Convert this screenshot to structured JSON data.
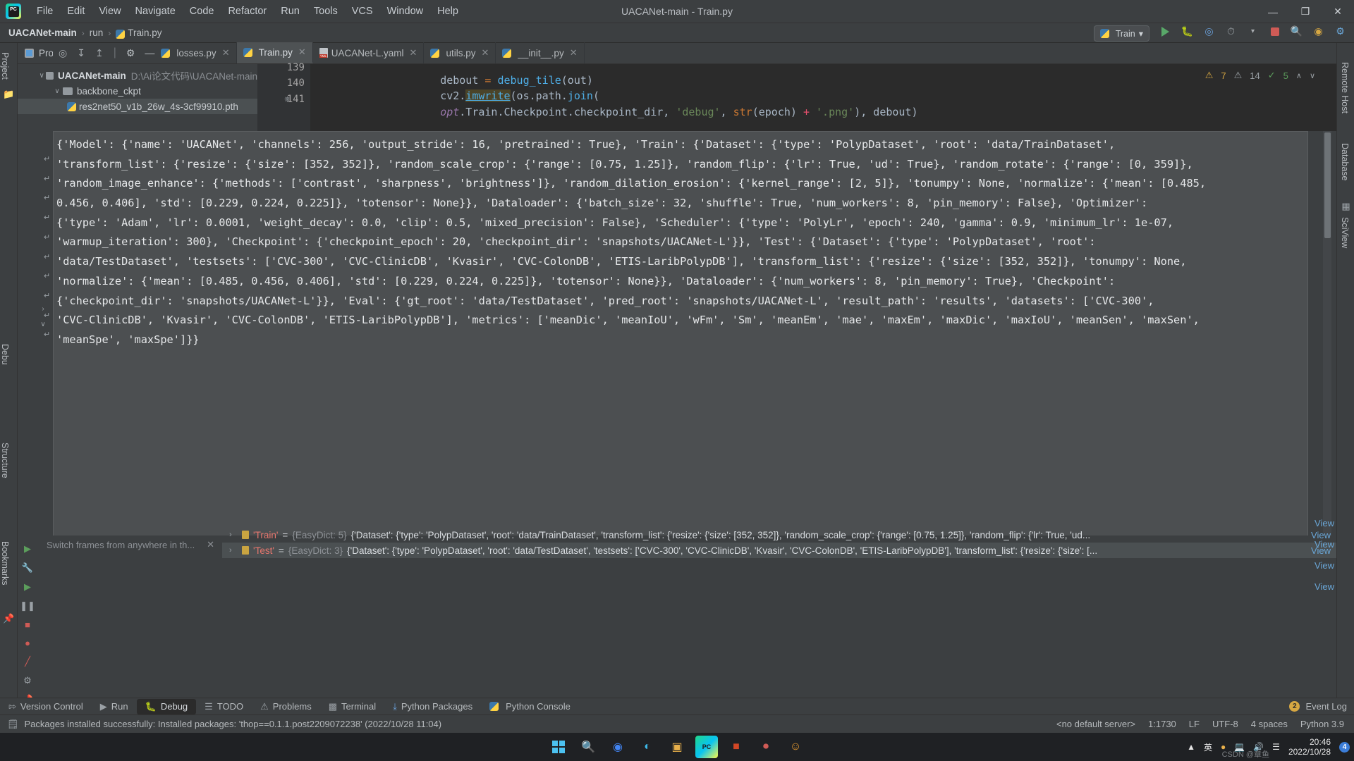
{
  "window": {
    "title": "UACANet-main - Train.py",
    "menu": [
      "File",
      "Edit",
      "View",
      "Navigate",
      "Code",
      "Refactor",
      "Run",
      "Tools",
      "VCS",
      "Window",
      "Help"
    ],
    "controls": {
      "minimize": "—",
      "maximize": "❐",
      "close": "✕"
    }
  },
  "breadcrumb": {
    "project": "UACANet-main",
    "folder": "run",
    "file": "Train.py",
    "separator": "›"
  },
  "run_config": {
    "name": "Train",
    "chevron": "▾"
  },
  "nav_icons": [
    "run-icon",
    "debug-icon",
    "coverage-icon",
    "profile-icon",
    "stop-icon",
    "search-icon",
    "updates-icon",
    "ide-icon"
  ],
  "tool_strip_left": {
    "project_label": "Project",
    "structure_label": "Structure",
    "bookmarks_label": "Bookmarks",
    "debug_label": "Debu"
  },
  "tool_strip_right": {
    "remote_host": "Remote Host",
    "database": "Database",
    "sciview": "SciView"
  },
  "project_panel": {
    "title": "Project",
    "chevron": "▾",
    "tree": [
      {
        "name": "UACANet-main",
        "path": "D:\\Ai论文代码\\UACANet-main",
        "arrow": "∨",
        "indent": 0,
        "bold": true,
        "type": "folder"
      },
      {
        "name": "backbone_ckpt",
        "path": "",
        "arrow": "∨",
        "indent": 1,
        "bold": false,
        "type": "folder"
      },
      {
        "name": "res2net50_v1b_26w_4s-3cf99910.pth",
        "path": "",
        "arrow": "",
        "indent": 2,
        "bold": false,
        "type": "file",
        "selected": true
      }
    ]
  },
  "editor_tabs": [
    {
      "label": "losses.py",
      "icon": "python-file-icon",
      "active": false,
      "close": "✕"
    },
    {
      "label": "Train.py",
      "icon": "python-file-icon",
      "active": true,
      "close": "✕"
    },
    {
      "label": "UACANet-L.yaml",
      "icon": "yaml-file-icon",
      "active": false,
      "close": "✕"
    },
    {
      "label": "utils.py",
      "icon": "python-file-icon",
      "active": false,
      "close": "✕"
    },
    {
      "label": "__init__.py",
      "icon": "python-file-icon",
      "active": false,
      "close": "✕"
    }
  ],
  "editor": {
    "lines": [
      {
        "num": "139",
        "text": "debout = debug_tile(out)"
      },
      {
        "num": "140",
        "text": "cv2.imwrite(os.path.join("
      },
      {
        "num": "141",
        "text": "opt.Train.Checkpoint.checkpoint_dir, 'debug', str(epoch) + '.png'), debout)"
      }
    ],
    "inspections": {
      "warnings": "7",
      "weak_warnings": "14",
      "typos": "5",
      "chevron_up": "∧",
      "chevron_down": "∨"
    }
  },
  "console": {
    "lines": [
      "{'Model': {'name': 'UACANet', 'channels': 256, 'output_stride': 16, 'pretrained': True}, 'Train': {'Dataset': {'type': 'PolypDataset', 'root': 'data/TrainDataset',",
      "'transform_list': {'resize': {'size': [352, 352]}, 'random_scale_crop': {'range': [0.75, 1.25]}, 'random_flip': {'lr': True, 'ud': True}, 'random_rotate': {'range': [0, 359]},",
      "'random_image_enhance': {'methods': ['contrast', 'sharpness', 'brightness']}, 'random_dilation_erosion': {'kernel_range': [2, 5]}, 'tonumpy': None, 'normalize': {'mean': [0.485,",
      "0.456, 0.406], 'std': [0.229, 0.224, 0.225]}, 'totensor': None}}, 'Dataloader': {'batch_size': 32, 'shuffle': True, 'num_workers': 8, 'pin_memory': False}, 'Optimizer':",
      "{'type': 'Adam', 'lr': 0.0001, 'weight_decay': 0.0, 'clip': 0.5, 'mixed_precision': False}, 'Scheduler': {'type': 'PolyLr', 'epoch': 240, 'gamma': 0.9, 'minimum_lr': 1e-07,",
      "'warmup_iteration': 300}, 'Checkpoint': {'checkpoint_epoch': 20, 'checkpoint_dir': 'snapshots/UACANet-L'}}, 'Test': {'Dataset': {'type': 'PolypDataset', 'root':",
      "'data/TestDataset', 'testsets': ['CVC-300', 'CVC-ClinicDB', 'Kvasir', 'CVC-ColonDB', 'ETIS-LaribPolypDB'], 'transform_list': {'resize': {'size': [352, 352]}, 'tonumpy': None,",
      "'normalize': {'mean': [0.485, 0.456, 0.406], 'std': [0.229, 0.224, 0.225]}, 'totensor': None}}, 'Dataloader': {'num_workers': 8, 'pin_memory': True}, 'Checkpoint':",
      "{'checkpoint_dir': 'snapshots/UACANet-L'}}, 'Eval': {'gt_root': 'data/TestDataset', 'pred_root': 'snapshots/UACANet-L', 'result_path': 'results', 'datasets': ['CVC-300',",
      "'CVC-ClinicDB', 'Kvasir', 'CVC-ColonDB', 'ETIS-LaribPolypDB'], 'metrics': ['meanDic', 'meanIoU', 'wFm', 'Sm', 'meanEm', 'mae', 'maxEm', 'maxDic', 'maxIoU', 'meanSen', 'maxSen',",
      "'meanSpe', 'maxSpe']}}"
    ],
    "wrap_glyph": "↵"
  },
  "debug_panel": {
    "frames_placeholder": "Switch frames from anywhere in th...",
    "close_glyph": "✕",
    "variables": [
      {
        "expand": "›",
        "name": "'Train'",
        "eq": "=",
        "type": "{EasyDict: 5}",
        "value": "{'Dataset': {'type': 'PolypDataset', 'root': 'data/TrainDataset', 'transform_list': {'resize': {'size': [352, 352]}, 'random_scale_crop': {'range': [0.75, 1.25]}, 'random_flip': {'lr': True, 'ud...",
        "view": "View",
        "selected": false
      },
      {
        "expand": "›",
        "name": "'Test'",
        "eq": "=",
        "type": "{EasyDict: 3}",
        "value": "{'Dataset': {'type': 'PolypDataset', 'root': 'data/TestDataset', 'testsets': ['CVC-300', 'CVC-ClinicDB', 'Kvasir', 'CVC-ColonDB', 'ETIS-LaribPolypDB'], 'transform_list': {'resize': {'size': [...",
        "view": "View",
        "selected": true
      }
    ],
    "view_links": [
      "View",
      "View",
      "View",
      "View",
      "View",
      "View"
    ]
  },
  "tool_window_bar": {
    "items": [
      {
        "label": "Version Control",
        "icon": "branch-icon",
        "active": false
      },
      {
        "label": "Run",
        "icon": "play-icon",
        "active": false
      },
      {
        "label": "Debug",
        "icon": "bug-icon",
        "active": true
      },
      {
        "label": "TODO",
        "icon": "list-icon",
        "active": false
      },
      {
        "label": "Problems",
        "icon": "warning-icon",
        "active": false
      },
      {
        "label": "Terminal",
        "icon": "terminal-icon",
        "active": false
      },
      {
        "label": "Python Packages",
        "icon": "packages-icon",
        "active": false
      },
      {
        "label": "Python Console",
        "icon": "python-icon",
        "active": false
      }
    ],
    "event_log": {
      "label": "Event Log",
      "count": "2"
    }
  },
  "status_bar": {
    "message": "Packages installed successfully: Installed packages: 'thop==0.1.1.post2209072238' (2022/10/28 11:04)",
    "right": [
      "<no default server>",
      "1:1730",
      "LF",
      "UTF-8",
      "4 spaces",
      "Python 3.9"
    ]
  },
  "taskbar": {
    "icons": [
      "windows-start-icon",
      "search-icon",
      "chrome-icon",
      "edge-icon",
      "snip-icon",
      "pycharm-icon",
      "powerpoint-icon",
      "recorder-icon",
      "wechat-icon"
    ],
    "tray": [
      "chevron-up-icon",
      "ime-icon",
      "sogou-icon",
      "monitor-icon",
      "volume-icon",
      "network-icon"
    ],
    "clock_time": "20:46",
    "clock_date": "2022/10/28",
    "watermark": "CSDN @章鱼",
    "badge": "4"
  }
}
